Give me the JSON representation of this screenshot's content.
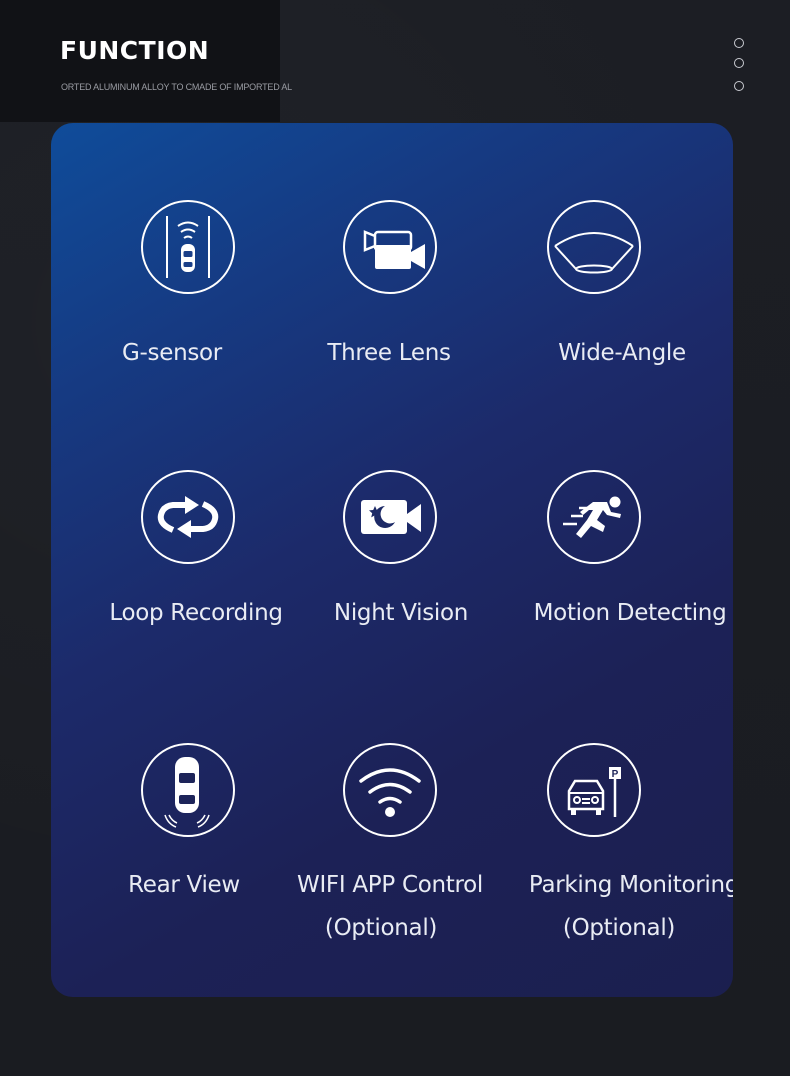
{
  "header": {
    "title": "FUNCTION",
    "subtitle": "ORTED ALUMINUM ALLOY TO CMADE OF IMPORTED AL",
    "dots_count": 3
  },
  "colors": {
    "background": "#1b1d22",
    "panel_top_left": "#0f4c9a",
    "panel_bottom_right": "#1b1f4f",
    "icon_stroke": "#ffffff",
    "label_text": "#e9ecf4"
  },
  "features": [
    {
      "icon": "g-sensor-icon",
      "label": "G-sensor",
      "label2": ""
    },
    {
      "icon": "three-lens-icon",
      "label": "Three Lens",
      "label2": ""
    },
    {
      "icon": "wide-angle-icon",
      "label": "Wide-Angle",
      "label2": ""
    },
    {
      "icon": "loop-recording-icon",
      "label": "Loop Recording",
      "label2": ""
    },
    {
      "icon": "night-vision-icon",
      "label": "Night Vision",
      "label2": ""
    },
    {
      "icon": "motion-detecting-icon",
      "label": "Motion Detecting",
      "label2": ""
    },
    {
      "icon": "rear-view-icon",
      "label": "Rear View",
      "label2": ""
    },
    {
      "icon": "wifi-icon",
      "label": "WIFI APP Control",
      "label2": "(Optional)"
    },
    {
      "icon": "parking-monitoring-icon",
      "label": "Parking Monitoring",
      "label2": "(Optional)"
    }
  ]
}
